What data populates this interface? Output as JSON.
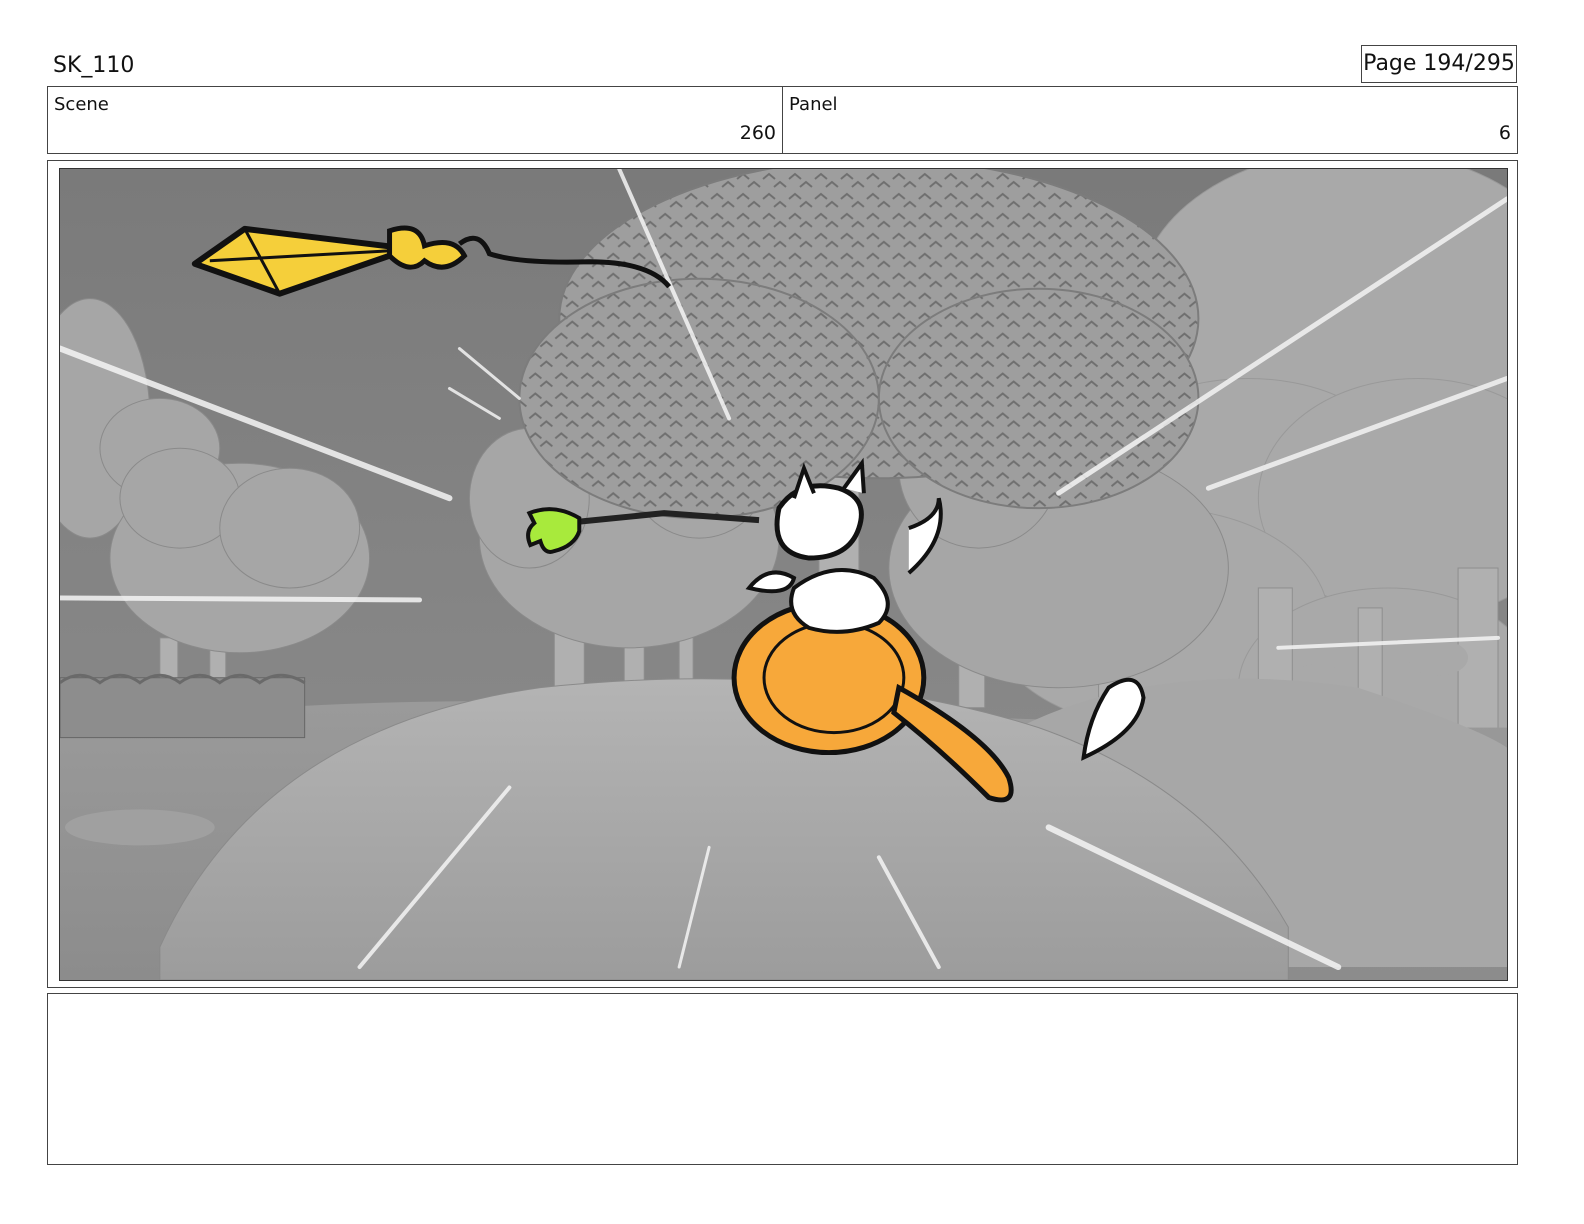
{
  "header": {
    "title": "SK_110",
    "page": "Page 194/295"
  },
  "info": {
    "scene_label": "Scene",
    "scene_value": "260",
    "panel_label": "Panel",
    "panel_value": "6"
  },
  "colors": {
    "kite": "#f5cf3a",
    "glove": "#a8ea3c",
    "body": "#f7a83a",
    "ink": "#111111"
  },
  "notes": {
    "text": ""
  }
}
